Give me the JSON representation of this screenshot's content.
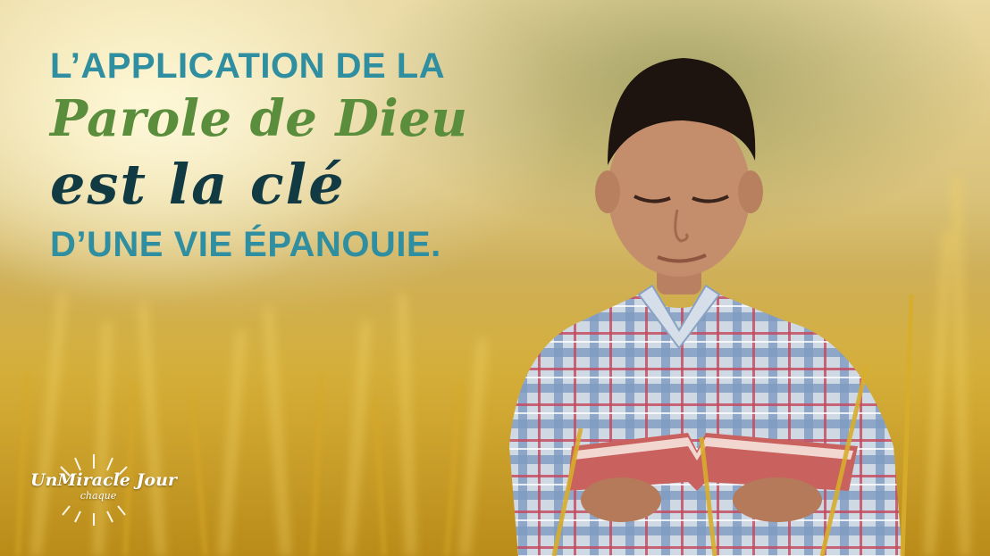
{
  "headline": {
    "line1": "L’APPLICATION DE LA",
    "line2": "Parole de Dieu",
    "line3": "est la clé",
    "line4": "D’UNE VIE ÉPANOUIE."
  },
  "logo": {
    "text_main": "UnMiracle Jour",
    "text_sub": "chaque"
  },
  "colors": {
    "teal": "#2f8fa0",
    "green": "#5a8e3c",
    "dark_teal": "#123a43",
    "field_gold": "#c99d2a"
  }
}
